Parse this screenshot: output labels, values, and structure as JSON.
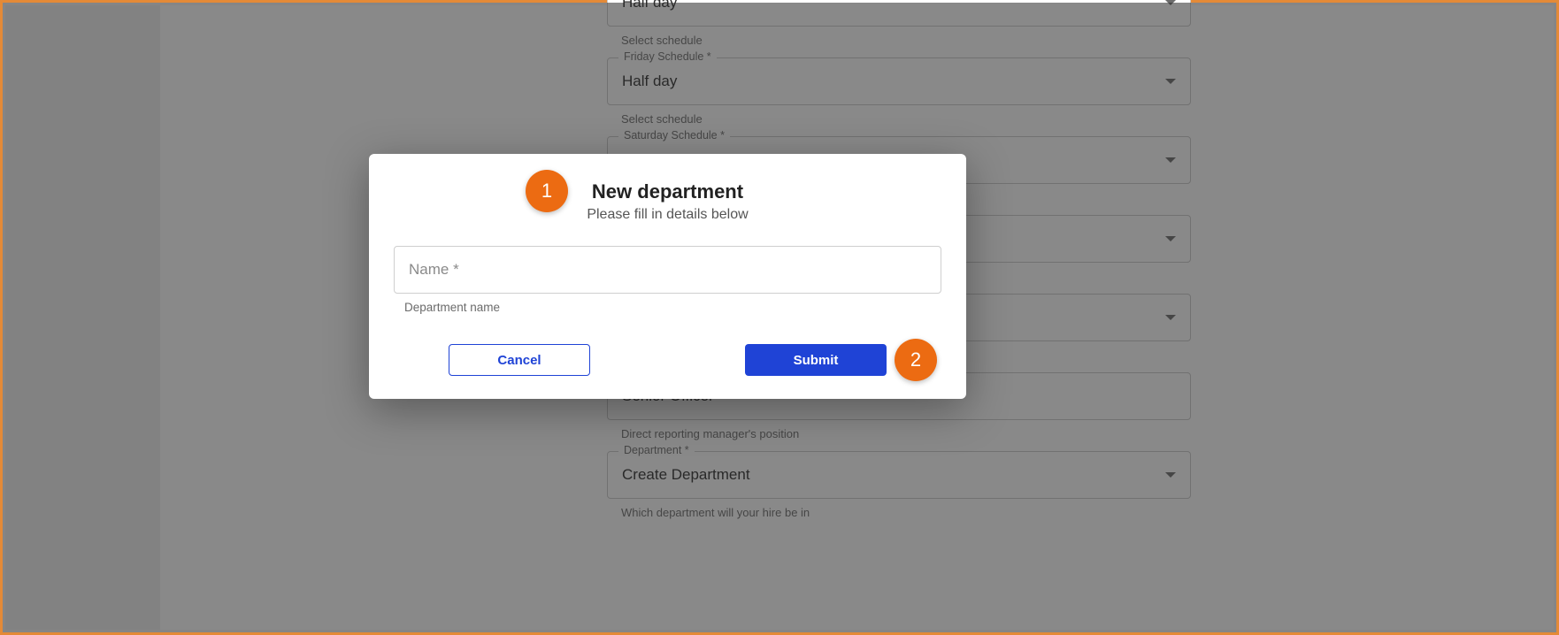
{
  "form": {
    "row0": {
      "value": "Half day",
      "helper": "Select schedule"
    },
    "row1": {
      "label": "Friday Schedule *",
      "value": "Half day",
      "helper": "Select schedule"
    },
    "row2": {
      "label": "Saturday Schedule *",
      "value": ""
    },
    "row3": {
      "label": "",
      "value": ""
    },
    "row4": {
      "label": "",
      "value": ""
    },
    "row5": {
      "label": "",
      "value": "Senior Officer",
      "helper": "Direct reporting manager's position"
    },
    "row6": {
      "label": "Department *",
      "value": "Create Department",
      "helper": "Which department will your hire be in"
    }
  },
  "modal": {
    "title": "New department",
    "subtitle": "Please fill in details below",
    "name_placeholder": "Name *",
    "name_helper": "Department name",
    "cancel_label": "Cancel",
    "submit_label": "Submit"
  },
  "badges": {
    "one": "1",
    "two": "2"
  }
}
